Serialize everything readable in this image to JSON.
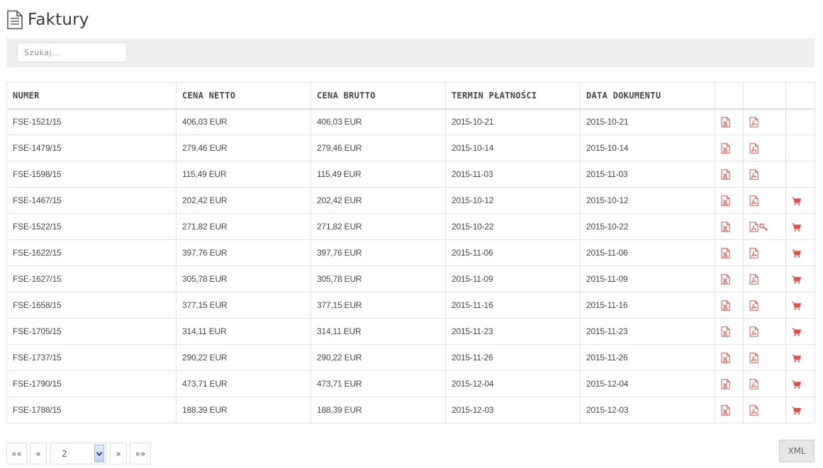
{
  "page": {
    "title": "Faktury",
    "icon": "document-icon"
  },
  "search": {
    "placeholder": "Szukaj..."
  },
  "table": {
    "headers": [
      "NUMER",
      "CENA NETTO",
      "CENA BRUTTO",
      "TERMIN PŁATNOŚCI",
      "DATA DOKUMENTU"
    ],
    "rows": [
      {
        "numer": "FSE-1521/15",
        "netto": "406,03 EUR",
        "brutto": "406,03 EUR",
        "termin": "2015-10-21",
        "data": "2015-10-21",
        "cart": false,
        "pdf_key": false
      },
      {
        "numer": "FSE-1479/15",
        "netto": "279,46 EUR",
        "brutto": "279,46 EUR",
        "termin": "2015-10-14",
        "data": "2015-10-14",
        "cart": false,
        "pdf_key": false
      },
      {
        "numer": "FSE-1598/15",
        "netto": "115,49 EUR",
        "brutto": "115,49 EUR",
        "termin": "2015-11-03",
        "data": "2015-11-03",
        "cart": false,
        "pdf_key": false
      },
      {
        "numer": "FSE-1467/15",
        "netto": "202,42 EUR",
        "brutto": "202,42 EUR",
        "termin": "2015-10-12",
        "data": "2015-10-12",
        "cart": true,
        "pdf_key": false
      },
      {
        "numer": "FSE-1522/15",
        "netto": "271,82 EUR",
        "brutto": "271,82 EUR",
        "termin": "2015-10-22",
        "data": "2015-10-22",
        "cart": true,
        "pdf_key": true
      },
      {
        "numer": "FSE-1622/15",
        "netto": "397,76 EUR",
        "brutto": "397,76 EUR",
        "termin": "2015-11-06",
        "data": "2015-11-06",
        "cart": true,
        "pdf_key": false
      },
      {
        "numer": "FSE-1627/15",
        "netto": "305,78 EUR",
        "brutto": "305,78 EUR",
        "termin": "2015-11-09",
        "data": "2015-11-09",
        "cart": true,
        "pdf_key": false
      },
      {
        "numer": "FSE-1658/15",
        "netto": "377,15 EUR",
        "brutto": "377,15 EUR",
        "termin": "2015-11-16",
        "data": "2015-11-16",
        "cart": true,
        "pdf_key": false
      },
      {
        "numer": "FSE-1705/15",
        "netto": "314,11 EUR",
        "brutto": "314,11 EUR",
        "termin": "2015-11-23",
        "data": "2015-11-23",
        "cart": true,
        "pdf_key": false
      },
      {
        "numer": "FSE-1737/15",
        "netto": "290,22 EUR",
        "brutto": "290,22 EUR",
        "termin": "2015-11-26",
        "data": "2015-11-26",
        "cart": true,
        "pdf_key": false
      },
      {
        "numer": "FSE-1790/15",
        "netto": "473,71 EUR",
        "brutto": "473,71 EUR",
        "termin": "2015-12-04",
        "data": "2015-12-04",
        "cart": true,
        "pdf_key": false
      },
      {
        "numer": "FSE-1788/15",
        "netto": "188,39 EUR",
        "brutto": "188,39 EUR",
        "termin": "2015-12-03",
        "data": "2015-12-03",
        "cart": true,
        "pdf_key": false
      }
    ]
  },
  "pagination": {
    "first_label": "««",
    "prev_label": "«",
    "current_page": "2",
    "next_label": "»",
    "last_label": "»»"
  },
  "export": {
    "xml_label": "XML"
  },
  "colors": {
    "accent": "#d9534f",
    "header_border": "#dddddd",
    "search_bg": "#efefef"
  },
  "icons": {
    "excel": "excel-file-icon",
    "pdf": "pdf-file-icon",
    "key": "key-icon",
    "cart": "cart-icon"
  }
}
